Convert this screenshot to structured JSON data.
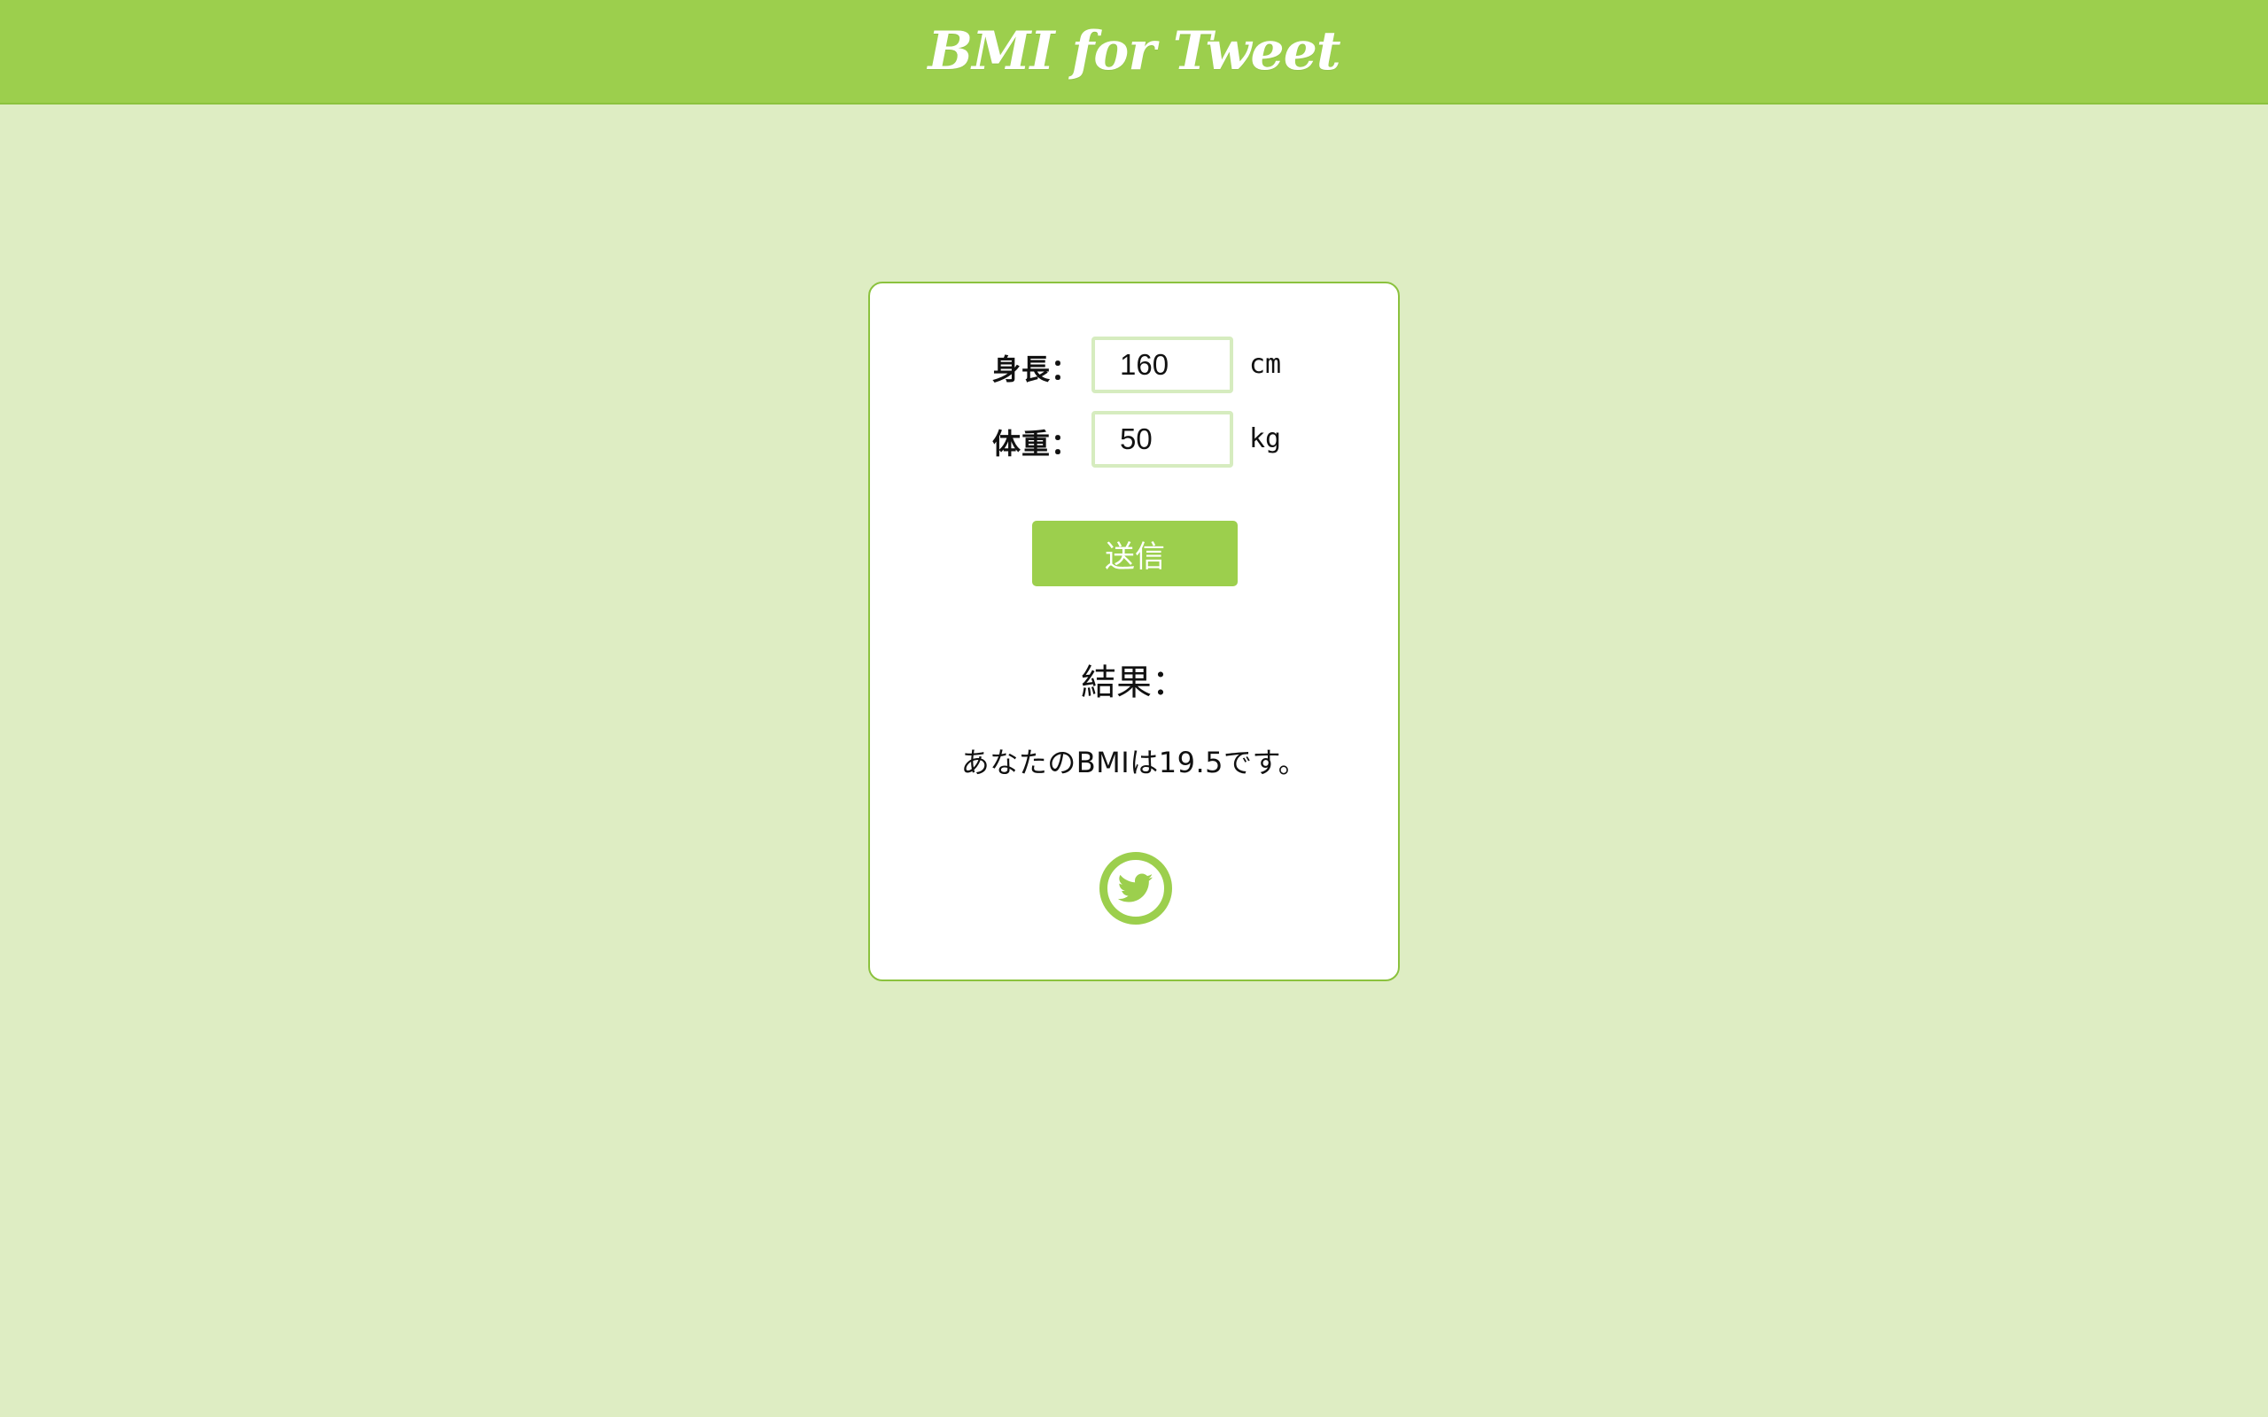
{
  "header": {
    "title": "BMI for Tweet"
  },
  "form": {
    "height": {
      "label": "身長：",
      "value": "160",
      "unit": "cm"
    },
    "weight": {
      "label": "体重：",
      "value": "50",
      "unit": "kg"
    },
    "submit_label": "送信"
  },
  "result": {
    "heading": "結果：",
    "text": "あなたのBMIは19.5です。"
  },
  "share": {
    "icon": "twitter-icon"
  },
  "colors": {
    "accent": "#9ccf4d",
    "background": "#deedc3",
    "card": "#ffffff",
    "input_border": "#d6ecbf"
  }
}
